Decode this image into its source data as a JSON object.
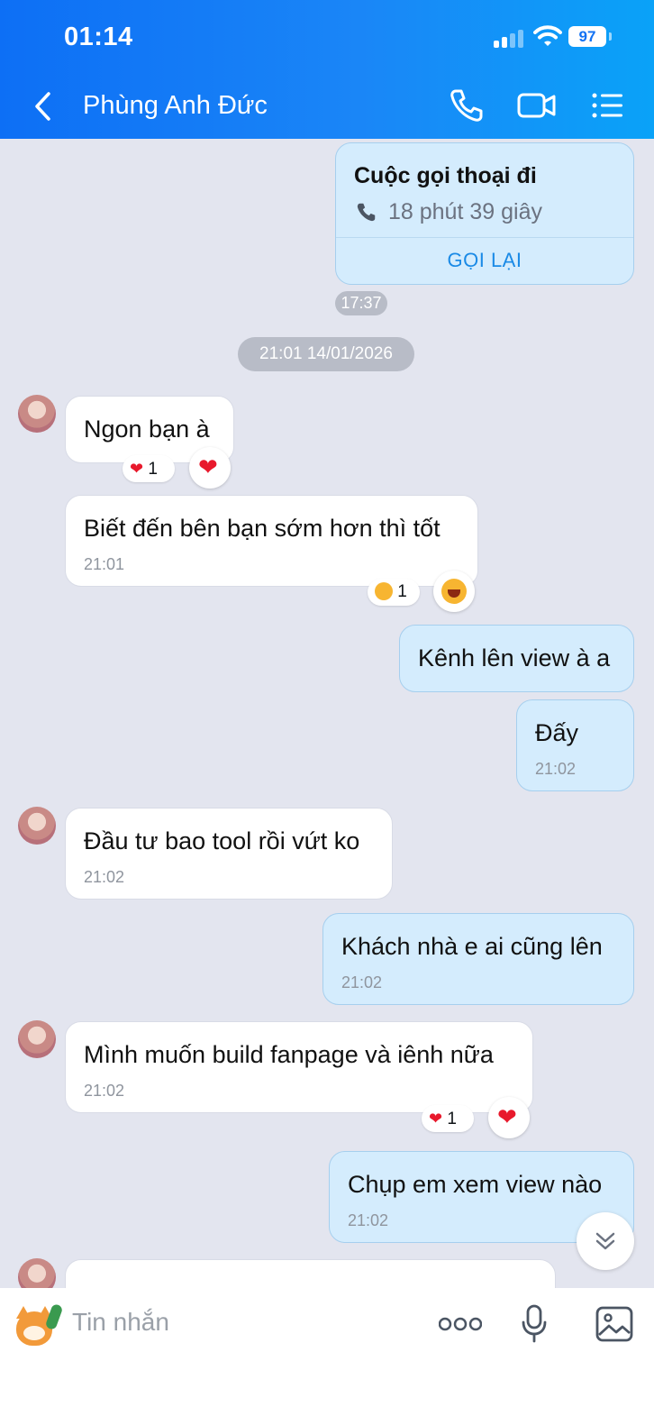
{
  "status_bar": {
    "time": "01:14",
    "battery": "97"
  },
  "header": {
    "contact_name": "Phùng Anh Đức"
  },
  "call_card": {
    "title": "Cuộc gọi thoại đi",
    "duration": "18 phút 39 giây",
    "action": "GỌI LẠI",
    "time": "17:37"
  },
  "date_divider": "21:01 14/01/2026",
  "messages": [
    {
      "dir": "in",
      "text": "Ngon bạn à",
      "reaction": "1"
    },
    {
      "dir": "in",
      "text": "Biết đến bên bạn sớm hơn thì tốt",
      "time": "21:01",
      "reaction": "1"
    },
    {
      "dir": "out",
      "text": "Kênh lên view à a"
    },
    {
      "dir": "out",
      "text": "Đấy",
      "time": "21:02"
    },
    {
      "dir": "in",
      "text": "Đầu tư bao tool rồi vứt ko",
      "time": "21:02"
    },
    {
      "dir": "out",
      "text": "Khách nhà e ai cũng lên",
      "time": "21:02"
    },
    {
      "dir": "in",
      "text": "Mình muốn build fanpage và iênh nữa",
      "time": "21:02",
      "reaction": "1"
    },
    {
      "dir": "out",
      "text": "Chụp em xem view nào",
      "time": "21:02"
    }
  ],
  "composer": {
    "placeholder": "Tin nhắn"
  },
  "icons": {
    "back": "chevron-left-icon",
    "call": "phone-icon",
    "video": "video-camera-icon",
    "menu": "list-menu-icon",
    "more": "more-dots-icon",
    "mic": "microphone-icon",
    "image": "image-icon",
    "sticker": "sticker-icon",
    "scroll": "chevron-double-down-icon"
  },
  "colors": {
    "header": "#1a86f7",
    "outgoing_bubble": "#d4ecfd",
    "incoming_bubble": "#ffffff",
    "accent": "#1a8ae6"
  }
}
